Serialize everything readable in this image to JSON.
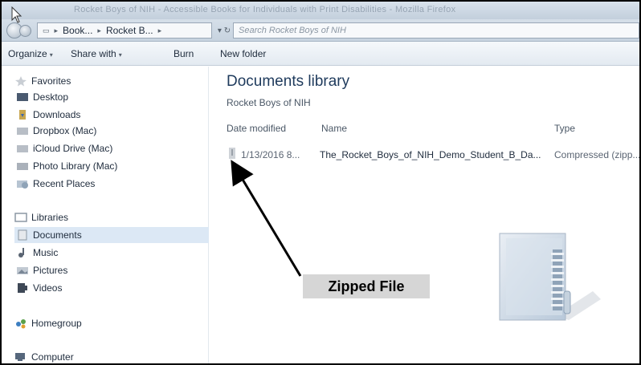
{
  "window": {
    "title": "Rocket Boys of NIH - Accessible Books for Individuals with Print Disabilities - Mozilla Firefox"
  },
  "address": {
    "crumbs": [
      "Book...",
      "Rocket B..."
    ],
    "search_placeholder": "Search Rocket Boys of NIH"
  },
  "toolbar": {
    "organize": "Organize",
    "share_with": "Share with",
    "burn": "Burn",
    "new_folder": "New folder"
  },
  "nav": {
    "favorites": "Favorites",
    "desktop": "Desktop",
    "downloads": "Downloads",
    "dropbox": "Dropbox (Mac)",
    "icloud": "iCloud Drive (Mac)",
    "photo_library": "Photo Library (Mac)",
    "recent_places": "Recent Places",
    "libraries": "Libraries",
    "documents": "Documents",
    "music": "Music",
    "pictures": "Pictures",
    "videos": "Videos",
    "homegroup": "Homegroup",
    "computer": "Computer"
  },
  "library": {
    "title": "Documents library",
    "subtitle": "Rocket Boys of NIH",
    "columns": {
      "date_modified": "Date modified",
      "name": "Name",
      "type": "Type"
    },
    "files": [
      {
        "date": "1/13/2016 8...",
        "name": "The_Rocket_Boys_of_NIH_Demo_Student_B_Da...",
        "type": "Compressed (zipp..."
      }
    ]
  },
  "annotation": {
    "label": "Zipped File"
  },
  "icons": {
    "back": "back-arrow-icon",
    "forward": "forward-arrow-icon",
    "search": "search-icon",
    "zip": "zipped-folder-icon"
  },
  "colors": {
    "accent": "#1e3a5c",
    "selection": "#dce8f5",
    "callout_bg": "#d6d6d6"
  }
}
